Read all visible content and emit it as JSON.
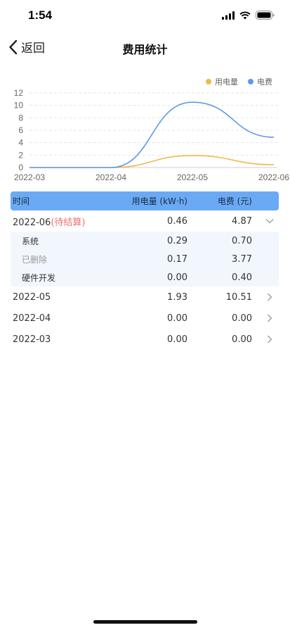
{
  "status": {
    "time": "1:54"
  },
  "nav": {
    "back_label": "返回",
    "title": "费用统计"
  },
  "legend": [
    {
      "name": "用电量",
      "color": "#f2b84b"
    },
    {
      "name": "电费",
      "color": "#5b9be8"
    }
  ],
  "chart_data": {
    "type": "line",
    "x": [
      "2022-03",
      "2022-04",
      "2022-05",
      "2022-06"
    ],
    "series": [
      {
        "name": "用电量",
        "color": "#f2b84b",
        "values": [
          0.0,
          0.0,
          1.93,
          0.46
        ]
      },
      {
        "name": "电费",
        "color": "#5b9be8",
        "values": [
          0.0,
          0.0,
          10.51,
          4.87
        ]
      }
    ],
    "yticks": [
      0,
      2,
      4,
      6,
      8,
      10,
      12
    ],
    "ylim": [
      0,
      12
    ],
    "grid": true,
    "legend_position": "top-right"
  },
  "table": {
    "headers": {
      "time": "时间",
      "energy": "用电量 (kW·h)",
      "fee": "电费 (元)"
    },
    "pending_row": {
      "month": "2022-06",
      "tag": "(待结算)",
      "energy": "0.46",
      "fee": "4.87"
    },
    "sub_rows": [
      {
        "label": "系统",
        "energy": "0.29",
        "fee": "0.70"
      },
      {
        "label": "已删除",
        "energy": "0.17",
        "fee": "3.77"
      },
      {
        "label": "硬件开发",
        "energy": "0.00",
        "fee": "0.40"
      }
    ],
    "rows": [
      {
        "month": "2022-05",
        "energy": "1.93",
        "fee": "10.51"
      },
      {
        "month": "2022-04",
        "energy": "0.00",
        "fee": "0.00"
      },
      {
        "month": "2022-03",
        "energy": "0.00",
        "fee": "0.00"
      }
    ]
  }
}
